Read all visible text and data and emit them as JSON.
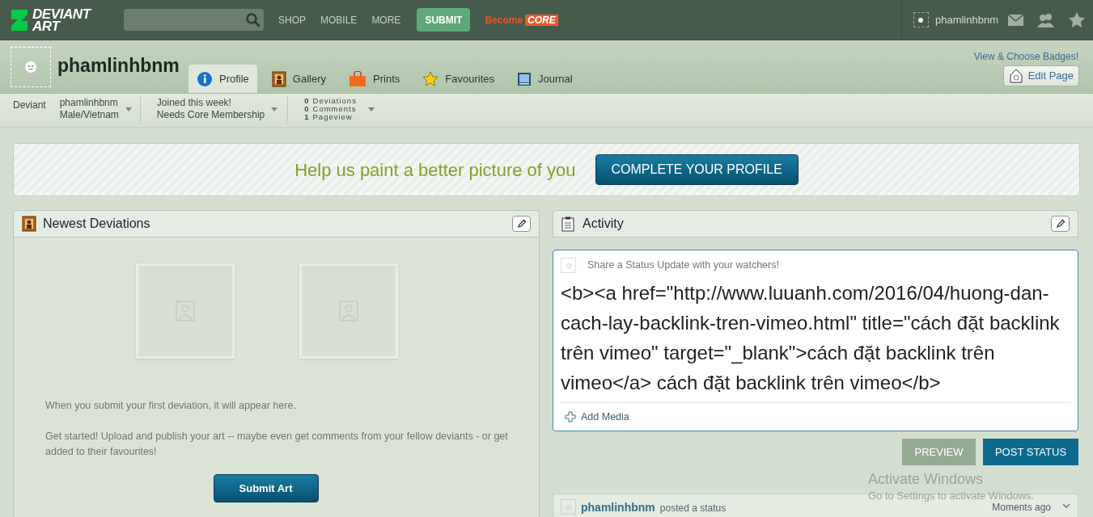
{
  "topbar": {
    "logo": [
      "DEVIANT",
      "ART"
    ],
    "search": {
      "kind": "search"
    },
    "nav": [
      "SHOP",
      "MOBILE",
      "MORE"
    ],
    "submit": "SUBMIT",
    "become": "Become",
    "core": "CORE",
    "username": "phamlinhbnm"
  },
  "profile": {
    "username": "phamlinhbnm",
    "badges_link": "View & Choose Badges!",
    "edit_page": "Edit Page",
    "tabs": [
      {
        "label": "Profile",
        "kind": "info",
        "selected": true
      },
      {
        "label": "Gallery",
        "kind": "gallery",
        "selected": false
      },
      {
        "label": "Prints",
        "kind": "prints",
        "selected": false
      },
      {
        "label": "Favourites",
        "kind": "star",
        "selected": false
      },
      {
        "label": "Journal",
        "kind": "journal",
        "selected": false
      }
    ],
    "info": {
      "role": "Deviant",
      "name": "phamlinhbnm",
      "location": "Male/Vietnam",
      "joined": "Joined this week!",
      "membership": "Needs Core Membership",
      "stats": [
        {
          "count": "0",
          "label": "Deviations"
        },
        {
          "count": "0",
          "label": "Comments"
        },
        {
          "count": "1",
          "label": "Pageview"
        }
      ]
    }
  },
  "banner": {
    "text": "Help us paint a better picture of you",
    "button": "COMPLETE YOUR PROFILE"
  },
  "newest": {
    "title": "Newest Deviations",
    "thumbnails": [
      {
        "kind": "empty"
      },
      {
        "kind": "empty"
      }
    ],
    "message": "When you submit your first deviation, it will appear here.",
    "hint": "Get started! Upload and publish your art -- maybe even get comments from your fellow deviants - or get added to their favourites!",
    "button": "Submit Art"
  },
  "activity": {
    "title": "Activity",
    "placeholder": "Share a Status Update with your watchers!",
    "value": "<b><a href=\"http://www.luuanh.com/2016/04/huong-dan-cach-lay-backlink-tren-vimeo.html\" title=\"cách đặt backlink trên vimeo\" target=\"_blank\">cách đặt backlink trên vimeo</a> cách đặt backlink trên vimeo</b>",
    "add_media": "Add Media",
    "preview": "PREVIEW",
    "post": "POST STATUS",
    "feed": [
      {
        "user": "phamlinhbnm",
        "action": "posted a status",
        "time": "Moments ago"
      }
    ]
  },
  "os_notice": {
    "title": "Activate Windows",
    "text": "Go to Settings to activate Windows."
  }
}
